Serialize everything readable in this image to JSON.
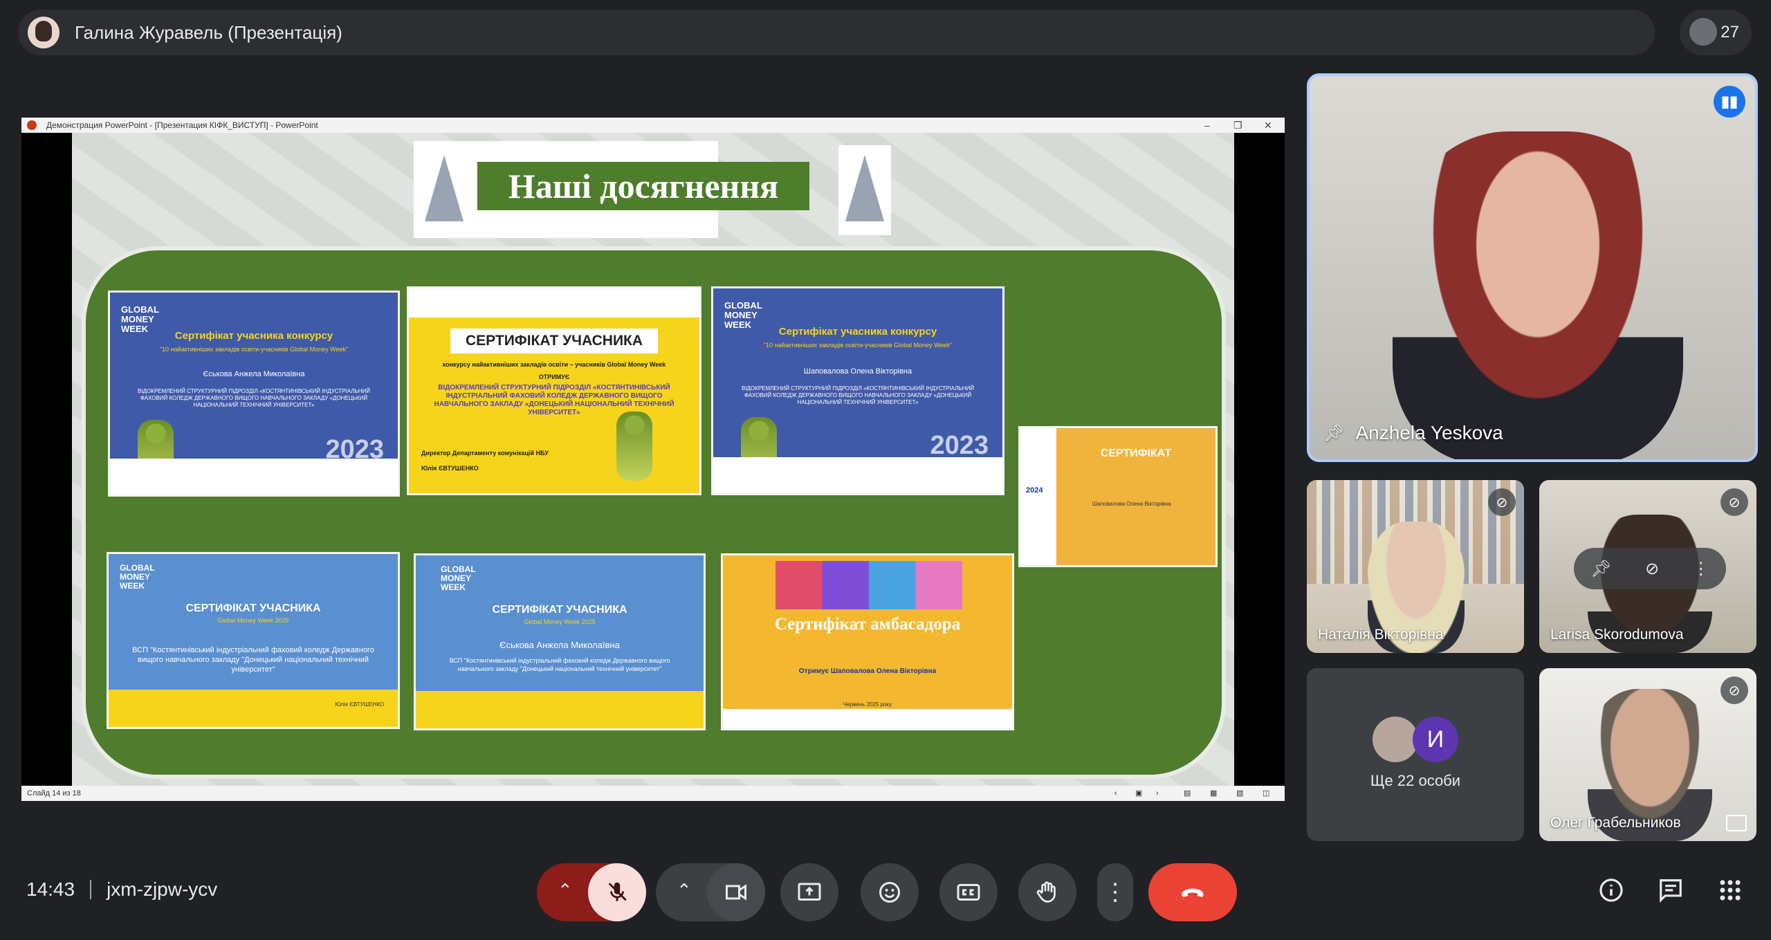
{
  "presenter": {
    "title": "Галина Журавель (Презентація)"
  },
  "participants_count": "27",
  "powerpoint": {
    "window_title": "Демонстрация PowerPoint - [Презентация КІФК_ВИСТУП] - PowerPoint",
    "status": "Слайд 14 из 18",
    "slide_title": "Наші досягнення",
    "certs": {
      "c1_title": "Сертифікат учасника конкурсу",
      "c1_sub": "\"10 найактивніших закладів освіти-учасників Global Money Week\"",
      "c1_name": "Єськова Анжела Миколаївна",
      "c1_org": "ВІДОКРЕМЛЕНИЙ СТРУКТУРНИЙ ПІДРОЗДІЛ «КОСТЯНТИНІВСЬКИЙ ІНДУСТРІАЛЬНИЙ ФАХОВИЙ КОЛЕДЖ ДЕРЖАВНОГО ВИЩОГО НАВЧАЛЬНОГО ЗАКЛАДУ «ДОНЕЦЬКИЙ НАЦІОНАЛЬНИЙ ТЕХНІЧНИЙ УНІВЕРСИТЕТ»",
      "c1_year": "2023",
      "c2_title": "СЕРТИФІКАТ УЧАСНИКА",
      "c2_sub": "конкурсу найактивніших закладів освіти – учасників Global Money Week",
      "c2_gets": "ОТРИМУЄ",
      "c2_org": "ВІДОКРЕМЛЕНИЙ СТРУКТУРНИЙ ПІДРОЗДІЛ «КОСТЯНТИНІВСЬКИЙ ІНДУСТРІАЛЬНИЙ ФАХОВИЙ КОЛЕДЖ ДЕРЖАВНОГО ВИЩОГО НАВЧАЛЬНОГО ЗАКЛАДУ «ДОНЕЦЬКИЙ НАЦІОНАЛЬНИЙ ТЕХНІЧНИЙ УНІВЕРСИТЕТ»",
      "c2_sign": "Директор Департаменту комунікацій НБУ",
      "c2_signer": "Юлія ЄВТУШЕНКО",
      "c3_title": "Сертифікат учасника конкурсу",
      "c3_sub": "\"10 найактивніших закладів освіти-учасників Global Money Week\"",
      "c3_name": "Шаповалова Олена Вікторівна",
      "c3_org": "ВІДОКРЕМЛЕНИЙ СТРУКТУРНИЙ ПІДРОЗДІЛ «КОСТЯНТИНІВСЬКИЙ ІНДУСТРІАЛЬНИЙ ФАХОВИЙ КОЛЕДЖ ДЕРЖАВНОГО ВИЩОГО НАВЧАЛЬНОГО ЗАКЛАДУ «ДОНЕЦЬКИЙ НАЦІОНАЛЬНИЙ ТЕХНІЧНИЙ УНІВЕРСИТЕТ»",
      "c3_year": "2023",
      "c4_title": "СЕРТИФІКАТ",
      "c4_year": "2024",
      "c4_name": "Шаповалова Олена Вікторівна",
      "c5_title": "СЕРТИФІКАТ УЧАСНИКА",
      "c5_sub": "Global Money Week 2025",
      "c5_org": "ВСП \"Костянтинівський індустріальний фаховий коледж Державного вищого навчального закладу \"Донецький національний технічний університет\"",
      "c5_signer": "Юлія ЄВТУШЕНКО",
      "c6_title": "СЕРТИФІКАТ УЧАСНИКА",
      "c6_sub": "Global Money Week 2025",
      "c6_name": "Єськова Анжела Миколаївна",
      "c6_org": "ВСП \"Костянтинівський індустріальний фаховий коледж Державного вищого навчального закладу \"Донецький національний технічний університет\"",
      "c7_title": "Сертифікат амбасадора",
      "c7_gets": "Отримує Шаповалова Олена Вікторівна",
      "c7_date": "Червень 2025 року"
    }
  },
  "tiles": {
    "main_name": "Anzhela Yeskova",
    "t1_name": "Наталія Вікторівна",
    "t2_name": "Larisa Skorodumova",
    "t3_more": "Ще 22 особи",
    "t3_initial": "И",
    "t4_name": "Олег Грабельников"
  },
  "bottom": {
    "time": "14:43",
    "meeting_code": "jxm-zjpw-ycv"
  },
  "icons": {
    "mic_off": "mic-off-icon",
    "camera": "videocam-icon",
    "present": "present-to-all-icon",
    "emoji": "emoji-icon",
    "captions": "closed-captions-icon",
    "hand": "raise-hand-icon",
    "more": "more-vert-icon",
    "leave": "call-end-icon",
    "info": "info-icon",
    "chat": "chat-icon",
    "activities": "apps-icon"
  },
  "colors": {
    "background": "#202124",
    "leave": "#ea4335",
    "mic_off_bg": "#f9dedc",
    "speaking": "#1a73e8",
    "active_border": "#aecbfa"
  }
}
